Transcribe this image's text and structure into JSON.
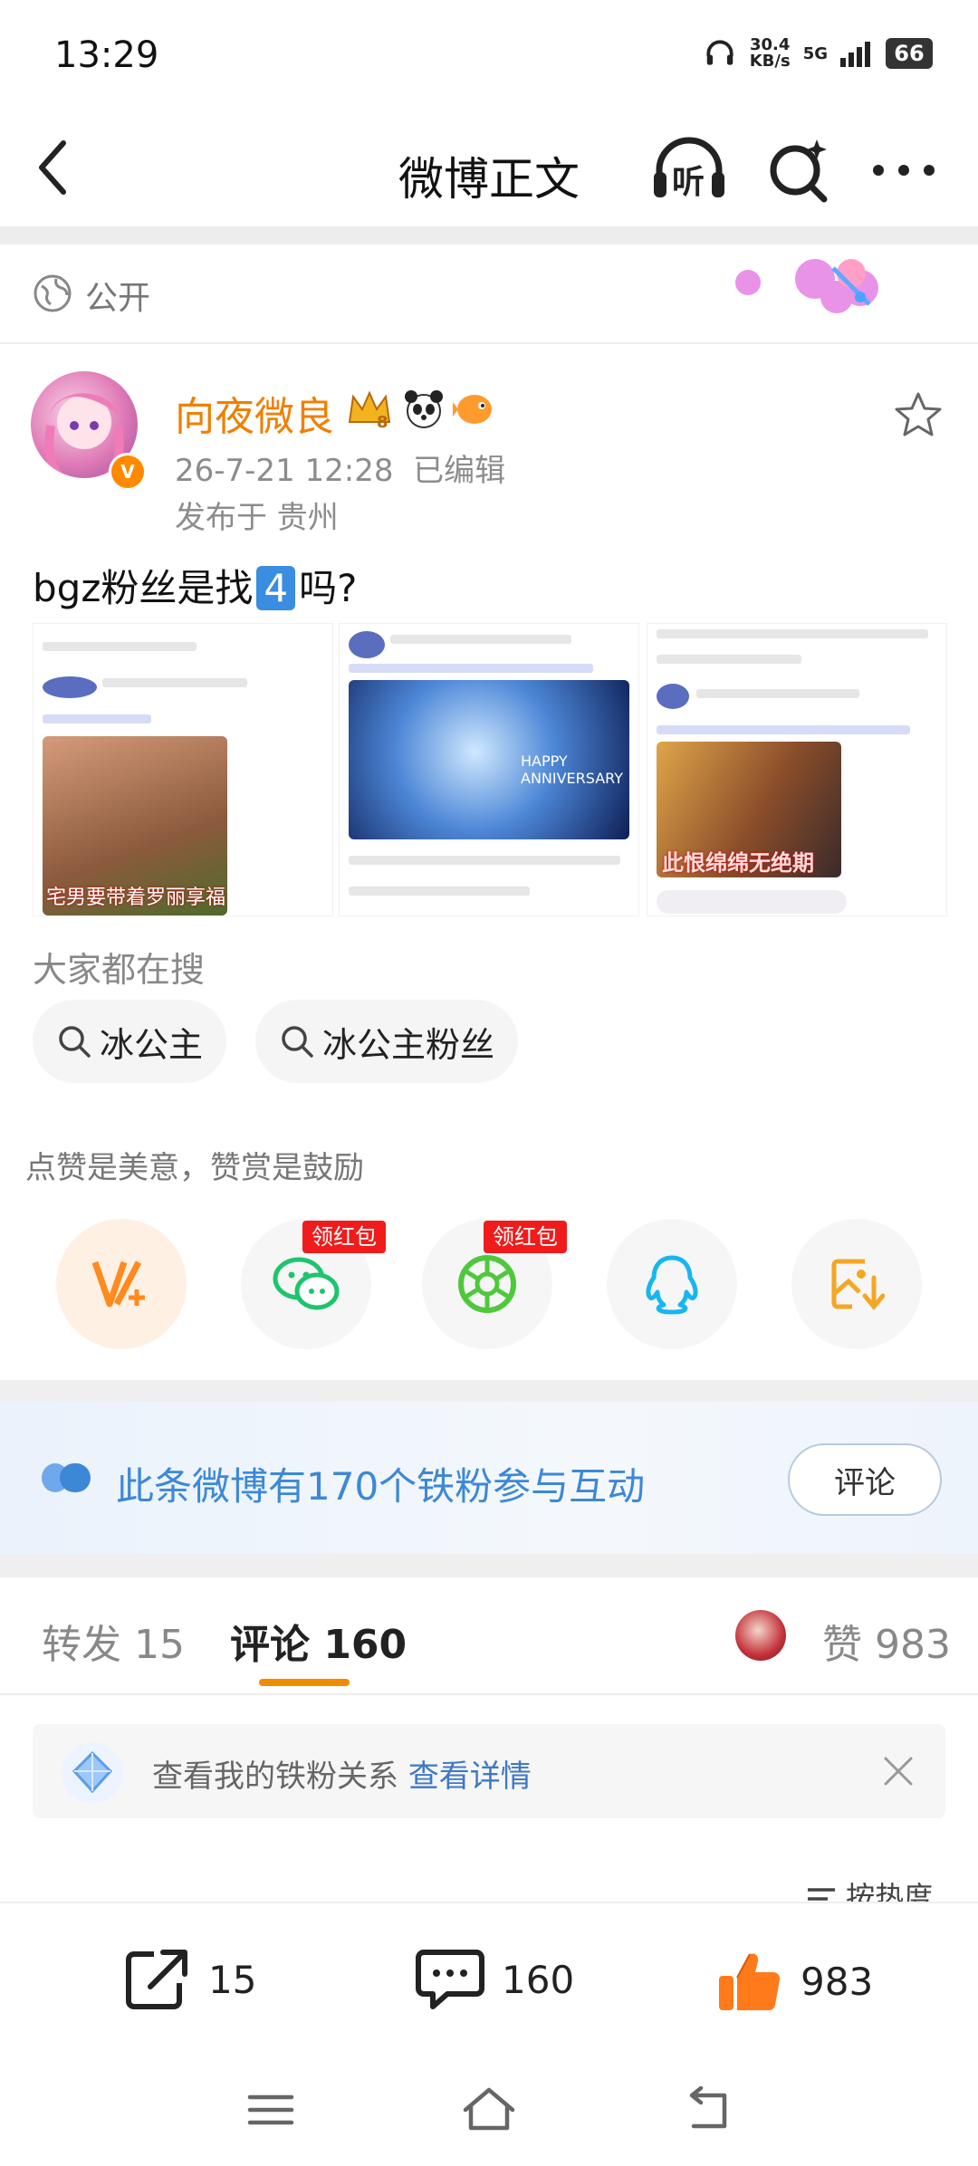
{
  "status_bar": {
    "time": "13:29",
    "speed_value": "30.4",
    "speed_unit": "KB/s",
    "network": "5G",
    "battery": "66"
  },
  "header": {
    "title": "微博正文",
    "back_icon": "back-chevron-icon",
    "listen_label": "听",
    "search_icon": "search-sparkle-icon",
    "more_icon": "more-dots-icon"
  },
  "visibility": {
    "label": "公开"
  },
  "post": {
    "username": "向夜微良",
    "time": "26-7-21 12:28",
    "edited": "已编辑",
    "location": "发布于 贵州",
    "text_prefix": "bgz粉丝是找",
    "text_emoji": "4",
    "text_suffix": "吗?"
  },
  "thumbnails": [
    {
      "caption": "宅男要带着罗丽享福"
    },
    {
      "caption": "HAPPY ANNIVERSARY"
    },
    {
      "caption": "此恨绵绵无绝期"
    }
  ],
  "search": {
    "title": "大家都在搜",
    "chips": [
      "冰公主",
      "冰公主粉丝"
    ]
  },
  "reward": {
    "text": "点赞是美意，赞赏是鼓励",
    "red_packet": "领红包",
    "share_icons": [
      "vip-reward-icon",
      "wechat-icon",
      "moments-icon",
      "qq-icon",
      "save-image-icon"
    ]
  },
  "fans": {
    "text": "此条微博有170个铁粉参与互动",
    "button": "评论"
  },
  "tabs": {
    "repost": "转发 15",
    "comment": "评论 160",
    "like": "赞 983"
  },
  "iron_card": {
    "text": "查看我的铁粉关系",
    "link": "查看详情"
  },
  "sort": {
    "label": "按热度"
  },
  "actions": {
    "repost": "15",
    "comment": "160",
    "like": "983"
  },
  "colors": {
    "accent": "#f08c00",
    "link": "#3e78c6",
    "like": "#ff7a1a",
    "fan_blue": "#3d88d6"
  }
}
